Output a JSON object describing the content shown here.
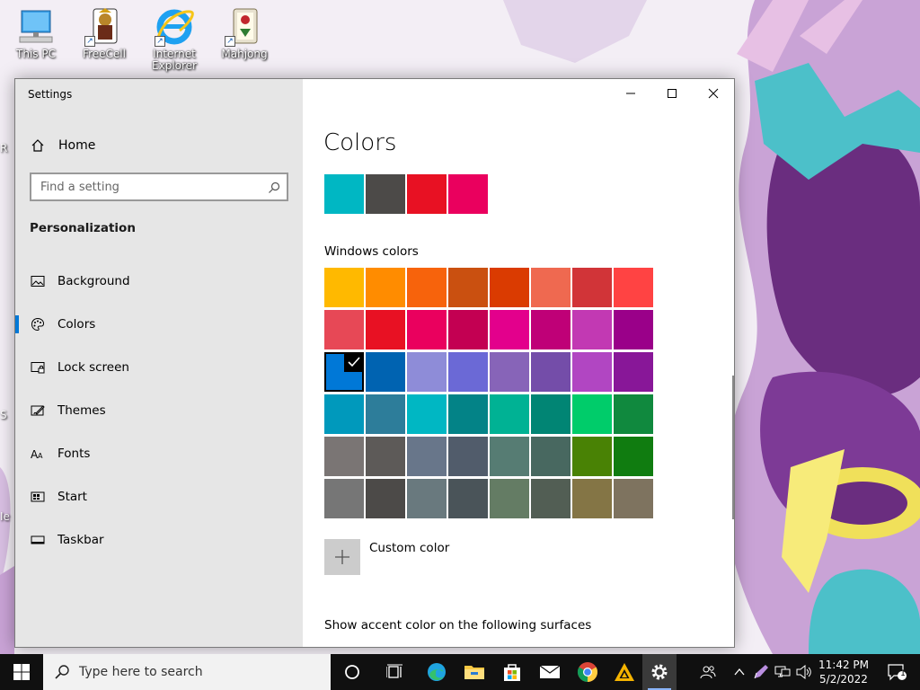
{
  "desktop": {
    "icons": [
      {
        "label": "This PC",
        "icon": "computer-icon"
      },
      {
        "label": "FreeCell",
        "icon": "freecell-icon"
      },
      {
        "label": "Internet Explorer",
        "icon": "internet-explorer-icon"
      },
      {
        "label": "Mahjong",
        "icon": "mahjong-icon"
      }
    ],
    "edge_fragments": [
      "R",
      "S",
      "Ie"
    ]
  },
  "window": {
    "title": "Settings",
    "caption_buttons": [
      "minimize-icon",
      "maximize-icon",
      "close-icon"
    ]
  },
  "sidebar": {
    "home_label": "Home",
    "search_placeholder": "Find a setting",
    "section_title": "Personalization",
    "items": [
      {
        "label": "Background",
        "icon": "picture-icon",
        "selected": false
      },
      {
        "label": "Colors",
        "icon": "palette-icon",
        "selected": true
      },
      {
        "label": "Lock screen",
        "icon": "lock-screen-icon",
        "selected": false
      },
      {
        "label": "Themes",
        "icon": "themes-icon",
        "selected": false
      },
      {
        "label": "Fonts",
        "icon": "fonts-icon",
        "selected": false
      },
      {
        "label": "Start",
        "icon": "start-icon",
        "selected": false
      },
      {
        "label": "Taskbar",
        "icon": "taskbar-icon",
        "selected": false
      }
    ]
  },
  "content": {
    "title": "Colors",
    "recent_colors": [
      "#00b7c3",
      "#4c4a48",
      "#e81123",
      "#ea005e"
    ],
    "windows_colors_label": "Windows colors",
    "windows_colors": [
      [
        "#ffb900",
        "#ff8c00",
        "#f7630c",
        "#ca5010",
        "#da3b01",
        "#ef6950",
        "#d13438",
        "#ff4343"
      ],
      [
        "#e74856",
        "#e81123",
        "#ea005e",
        "#c30052",
        "#e3008c",
        "#bf0077",
        "#c239b3",
        "#9a0089"
      ],
      [
        "#0078d7",
        "#0063b1",
        "#8e8cd8",
        "#6b69d6",
        "#8764b8",
        "#744da9",
        "#b146c2",
        "#881798"
      ],
      [
        "#0099bc",
        "#2d7d9a",
        "#00b7c3",
        "#038387",
        "#00b294",
        "#018574",
        "#00cc6a",
        "#10893e"
      ],
      [
        "#7a7574",
        "#5d5a58",
        "#68768a",
        "#515c6b",
        "#567c73",
        "#486860",
        "#498205",
        "#107c10"
      ],
      [
        "#767676",
        "#4c4a48",
        "#69797e",
        "#4a5459",
        "#647c64",
        "#525e54",
        "#847545",
        "#7e735f"
      ]
    ],
    "selected_color": "#0078d7",
    "custom_color_label": "Custom color",
    "surfaces_label": "Show accent color on the following surfaces"
  },
  "taskbar": {
    "search_placeholder": "Type here to search",
    "apps": [
      "cortana-icon",
      "task-view-icon",
      "edge-icon",
      "file-explorer-icon",
      "store-icon",
      "mail-icon",
      "chrome-icon",
      "app-icon",
      "settings-icon"
    ],
    "tray": [
      "people-icon",
      "chevron-up-icon",
      "pen-icon",
      "network-icon",
      "volume-icon"
    ],
    "time": "11:42 PM",
    "date": "5/2/2022",
    "notification_count": "1"
  }
}
